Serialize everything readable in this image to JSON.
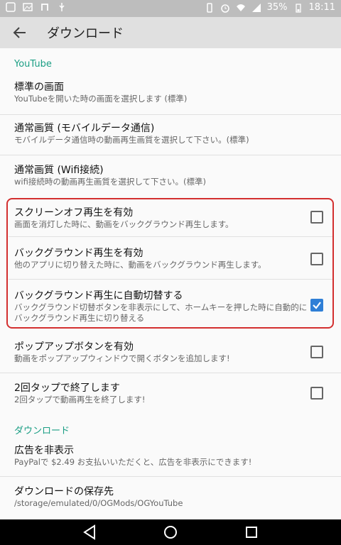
{
  "status_bar": {
    "battery": "35%",
    "time": "18:11",
    "icons": [
      "notification-icon",
      "image-icon",
      "n-icon",
      "usb-icon",
      "vibrate-icon",
      "alarm-icon",
      "wifi-icon",
      "signal-icon",
      "battery-icon"
    ]
  },
  "toolbar": {
    "title": "ダウンロード"
  },
  "sections": {
    "youtube": "YouTube",
    "download": "ダウンロード"
  },
  "items": [
    {
      "title": "標準の画面",
      "summary": "YouTubeを開いた時の画面を選択します (標準)"
    },
    {
      "title": "通常画質 (モバイルデータ通信)",
      "summary": "モバイルデータ通信時の動画再生画質を選択して下さい。(標準)"
    },
    {
      "title": "通常画質 (Wifi接続)",
      "summary": "wifi接続時の動画再生画質を選択して下さい。(標準)"
    },
    {
      "title": "スクリーンオフ再生を有効",
      "summary": "画面を消灯した時に、動画をバックグラウンド再生します。",
      "checked": false
    },
    {
      "title": "バックグラウンド再生を有効",
      "summary": "他のアプリに切り替えた時に、動画をバックグラウンド再生します。",
      "checked": false
    },
    {
      "title": "バックグラウンド再生に自動切替する",
      "summary_line1": "バックグラウンド切替ボタンを非表示にして、ホームキーを押した時に自動的に",
      "summary_line2": "バックグラウンド再生に切り替える",
      "checked": true
    },
    {
      "title": "ポップアップボタンを有効",
      "summary": "動画をポップアップウィンドウで開くボタンを追加します!",
      "checked": false
    },
    {
      "title": "2回タップで終了します",
      "summary": "2回タップで動画再生を終了します!",
      "checked": false
    },
    {
      "title": "広告を非表示",
      "summary": "PayPalで $2.49 お支払いいただくと、広告を非表示にできます!"
    },
    {
      "title": "ダウンロードの保存先",
      "summary": "/storage/emulated/0/OGMods/OGYouTube"
    }
  ],
  "colors": {
    "accent": "#1a9e84",
    "checkbox_checked": "#2f7fd6",
    "highlight": "#d32f2f"
  }
}
